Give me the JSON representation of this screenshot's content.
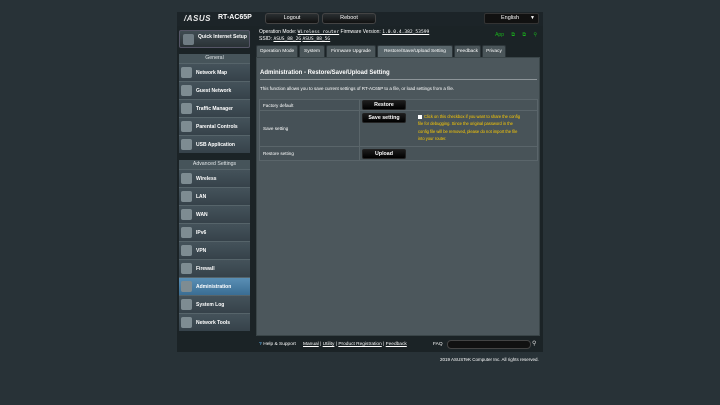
{
  "header": {
    "logo": "/ASUS",
    "model": "RT-AC65P",
    "logout_label": "Logout",
    "reboot_label": "Reboot",
    "language": "English"
  },
  "info": {
    "op_mode_label": "Operation Mode:",
    "op_mode_value": "Wireless router",
    "fw_label": "Firmware Version:",
    "fw_value": "1.0.0.4.382_53599",
    "ssid_label": "SSID:",
    "ssid_1": "ASUS_88_2G",
    "ssid_2": "ASUS_88_5G",
    "app_label": "App"
  },
  "sidebar": {
    "quick_setup": "Quick Internet Setup",
    "general_header": "General",
    "general_items": [
      {
        "label": "Network Map"
      },
      {
        "label": "Guest Network"
      },
      {
        "label": "Traffic Manager"
      },
      {
        "label": "Parental Controls"
      },
      {
        "label": "USB Application"
      }
    ],
    "advanced_header": "Advanced Settings",
    "advanced_items": [
      {
        "label": "Wireless"
      },
      {
        "label": "LAN"
      },
      {
        "label": "WAN"
      },
      {
        "label": "IPv6"
      },
      {
        "label": "VPN"
      },
      {
        "label": "Firewall"
      },
      {
        "label": "Administration"
      },
      {
        "label": "System Log"
      },
      {
        "label": "Network Tools"
      }
    ]
  },
  "tabs": [
    {
      "label": "Operation Mode"
    },
    {
      "label": "System"
    },
    {
      "label": "Firmware Upgrade"
    },
    {
      "label": "Restore/Save/Upload Setting"
    },
    {
      "label": "Feedback"
    },
    {
      "label": "Privacy"
    }
  ],
  "main": {
    "title": "Administration - Restore/Save/Upload Setting",
    "description": "This function allows you to save current settings of RT-AC65P to a file, or load settings from a file.",
    "factory_default_label": "Factory default",
    "restore_button": "Restore",
    "save_setting_label": "Save setting",
    "save_button": "Save setting",
    "save_note": "Click on this checkbox if you want to share the config file for debugging. Since the original password in the config file will be removed, please do not import the file into your router.",
    "restore_setting_label": "Restore setting",
    "upload_button": "Upload"
  },
  "footer": {
    "help": "Help & Support",
    "manual": "Manual",
    "utility": "Utility",
    "product_registration": "Product Registration",
    "feedback": "Feedback",
    "faq": "FAQ",
    "copyright": "2019 ASUSTeK Computer Inc. All rights reserved."
  },
  "colors": {
    "background": "#283237",
    "accent_active": "#3a6d93",
    "note": "#ffcc00",
    "status_green": "#19b21c"
  }
}
